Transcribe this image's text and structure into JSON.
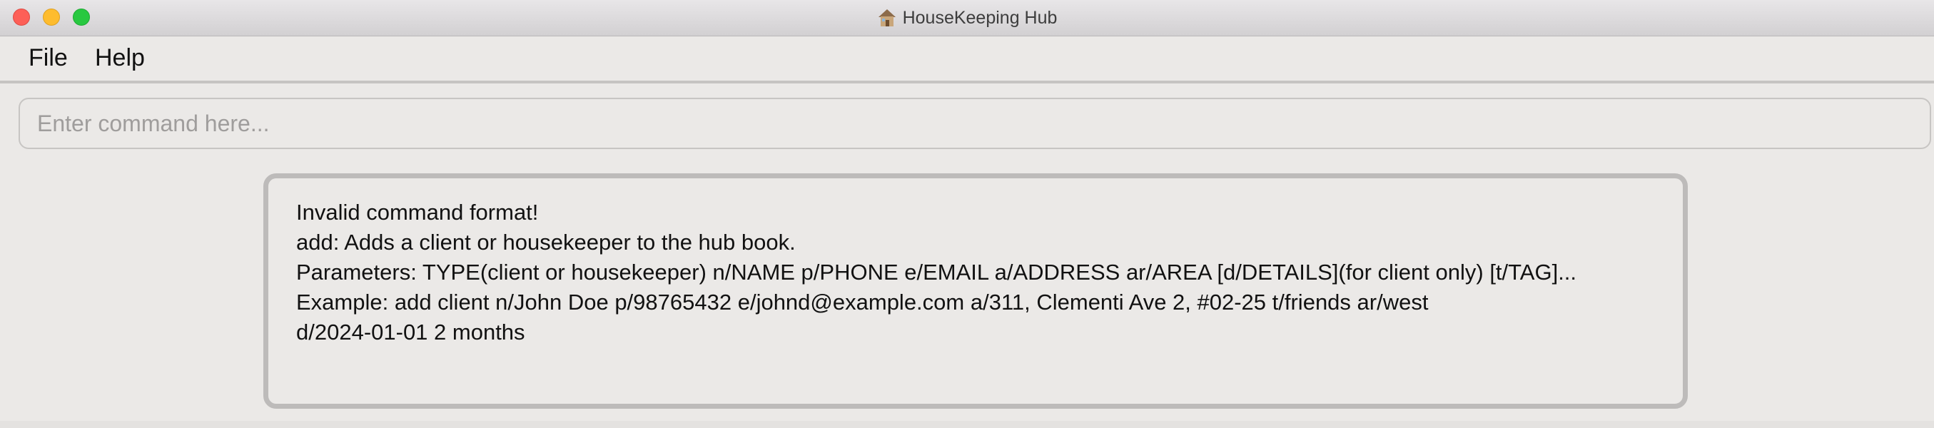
{
  "window": {
    "title": "HouseKeeping Hub",
    "app_icon": "house-icon",
    "controls": [
      "close",
      "minimize",
      "maximize"
    ]
  },
  "menu": {
    "items": [
      {
        "label": "File"
      },
      {
        "label": "Help"
      }
    ]
  },
  "command": {
    "value": "",
    "placeholder": "Enter command here..."
  },
  "result": {
    "lines": [
      "Invalid command format!",
      "add: Adds a client or housekeeper to the hub book.",
      "Parameters: TYPE(client or housekeeper) n/NAME p/PHONE e/EMAIL a/ADDRESS ar/AREA [d/DETAILS](for client only) [t/TAG]...",
      "Example: add client n/John Doe p/98765432 e/johnd@example.com a/311, Clementi Ave 2, #02-25 t/friends ar/west",
      "d/2024-01-01 2 months"
    ]
  },
  "colors": {
    "close": "#fd5f57",
    "minimize": "#febc2e",
    "maximize": "#28c840",
    "background": "#ebe9e7",
    "border": "#bdbbba"
  }
}
